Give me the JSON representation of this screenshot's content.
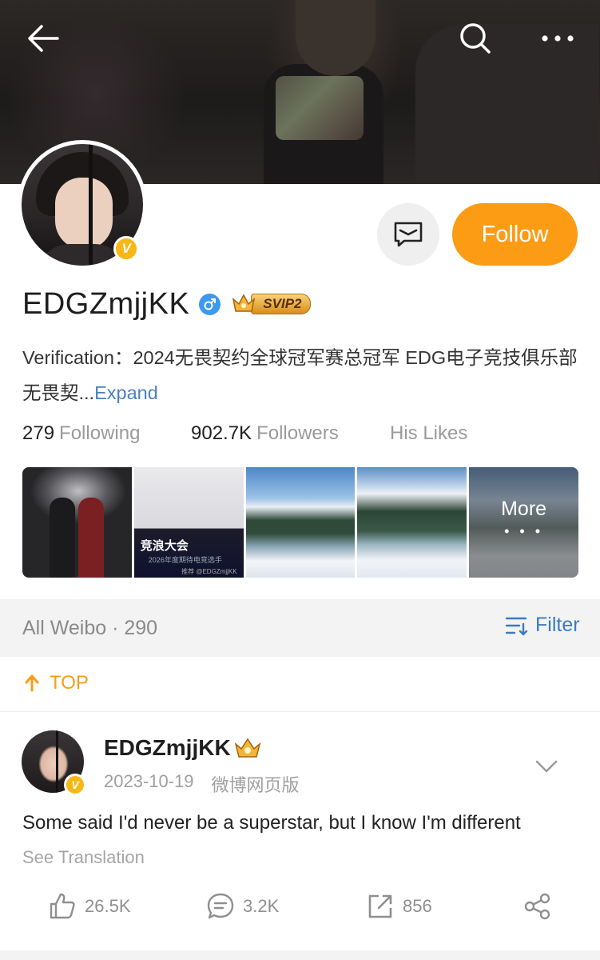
{
  "header": {
    "back_icon": "arrow-left-icon",
    "search_icon": "search-icon",
    "more_icon": "more-horizontal-icon"
  },
  "profile": {
    "name": "EDGZmjjKK",
    "verified_badge": "V",
    "gender_icon": "male-icon",
    "vip_label": "SVIP2",
    "follow_label": "Follow",
    "message_icon": "message-icon",
    "verification_text": "Verification：2024无畏契约全球冠军赛总冠军  EDG电子竞技俱乐部无畏契...",
    "expand_label": "Expand",
    "stats": {
      "following_count": "279",
      "following_label": "Following",
      "followers_count": "902.7K",
      "followers_label": "Followers",
      "likes_label": "His Likes"
    },
    "album": {
      "photo2_caption": "竞浪大会",
      "photo2_sub": "2026年度期待电竞选手",
      "photo2_credit": "推荐 @EDGZmjjKK",
      "more_label": "More",
      "more_dots": "• • •"
    }
  },
  "weibo_bar": {
    "label": "All Weibo · 290",
    "filter_label": "Filter"
  },
  "pinned": {
    "label": "TOP"
  },
  "post": {
    "author": "EDGZmjjKK",
    "date": "2023-10-19",
    "source": "微博网页版",
    "text": "Some said I'd never be a superstar, but I know I'm different",
    "translate_label": "See Translation",
    "likes": "26.5K",
    "comments": "3.2K",
    "reposts": "856"
  },
  "colors": {
    "accent": "#fb9c14",
    "link": "#4a7fbf",
    "filter": "#3d7ac1",
    "verified": "#f8b814"
  }
}
